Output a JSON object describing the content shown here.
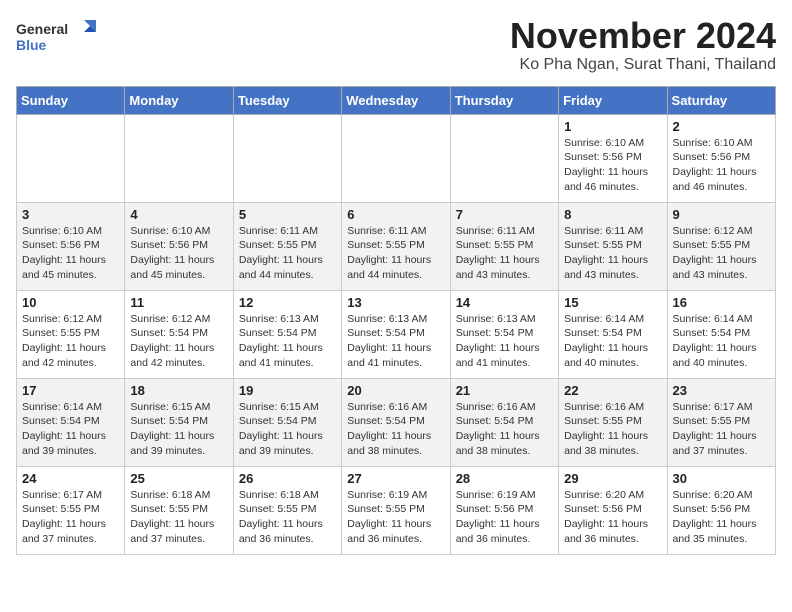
{
  "logo": {
    "line1": "General",
    "line2": "Blue"
  },
  "title": {
    "month": "November 2024",
    "location": "Ko Pha Ngan, Surat Thani, Thailand"
  },
  "weekdays": [
    "Sunday",
    "Monday",
    "Tuesday",
    "Wednesday",
    "Thursday",
    "Friday",
    "Saturday"
  ],
  "weeks": [
    [
      {
        "day": "",
        "info": ""
      },
      {
        "day": "",
        "info": ""
      },
      {
        "day": "",
        "info": ""
      },
      {
        "day": "",
        "info": ""
      },
      {
        "day": "",
        "info": ""
      },
      {
        "day": "1",
        "info": "Sunrise: 6:10 AM\nSunset: 5:56 PM\nDaylight: 11 hours and 46 minutes."
      },
      {
        "day": "2",
        "info": "Sunrise: 6:10 AM\nSunset: 5:56 PM\nDaylight: 11 hours and 46 minutes."
      }
    ],
    [
      {
        "day": "3",
        "info": "Sunrise: 6:10 AM\nSunset: 5:56 PM\nDaylight: 11 hours and 45 minutes."
      },
      {
        "day": "4",
        "info": "Sunrise: 6:10 AM\nSunset: 5:56 PM\nDaylight: 11 hours and 45 minutes."
      },
      {
        "day": "5",
        "info": "Sunrise: 6:11 AM\nSunset: 5:55 PM\nDaylight: 11 hours and 44 minutes."
      },
      {
        "day": "6",
        "info": "Sunrise: 6:11 AM\nSunset: 5:55 PM\nDaylight: 11 hours and 44 minutes."
      },
      {
        "day": "7",
        "info": "Sunrise: 6:11 AM\nSunset: 5:55 PM\nDaylight: 11 hours and 43 minutes."
      },
      {
        "day": "8",
        "info": "Sunrise: 6:11 AM\nSunset: 5:55 PM\nDaylight: 11 hours and 43 minutes."
      },
      {
        "day": "9",
        "info": "Sunrise: 6:12 AM\nSunset: 5:55 PM\nDaylight: 11 hours and 43 minutes."
      }
    ],
    [
      {
        "day": "10",
        "info": "Sunrise: 6:12 AM\nSunset: 5:55 PM\nDaylight: 11 hours and 42 minutes."
      },
      {
        "day": "11",
        "info": "Sunrise: 6:12 AM\nSunset: 5:54 PM\nDaylight: 11 hours and 42 minutes."
      },
      {
        "day": "12",
        "info": "Sunrise: 6:13 AM\nSunset: 5:54 PM\nDaylight: 11 hours and 41 minutes."
      },
      {
        "day": "13",
        "info": "Sunrise: 6:13 AM\nSunset: 5:54 PM\nDaylight: 11 hours and 41 minutes."
      },
      {
        "day": "14",
        "info": "Sunrise: 6:13 AM\nSunset: 5:54 PM\nDaylight: 11 hours and 41 minutes."
      },
      {
        "day": "15",
        "info": "Sunrise: 6:14 AM\nSunset: 5:54 PM\nDaylight: 11 hours and 40 minutes."
      },
      {
        "day": "16",
        "info": "Sunrise: 6:14 AM\nSunset: 5:54 PM\nDaylight: 11 hours and 40 minutes."
      }
    ],
    [
      {
        "day": "17",
        "info": "Sunrise: 6:14 AM\nSunset: 5:54 PM\nDaylight: 11 hours and 39 minutes."
      },
      {
        "day": "18",
        "info": "Sunrise: 6:15 AM\nSunset: 5:54 PM\nDaylight: 11 hours and 39 minutes."
      },
      {
        "day": "19",
        "info": "Sunrise: 6:15 AM\nSunset: 5:54 PM\nDaylight: 11 hours and 39 minutes."
      },
      {
        "day": "20",
        "info": "Sunrise: 6:16 AM\nSunset: 5:54 PM\nDaylight: 11 hours and 38 minutes."
      },
      {
        "day": "21",
        "info": "Sunrise: 6:16 AM\nSunset: 5:54 PM\nDaylight: 11 hours and 38 minutes."
      },
      {
        "day": "22",
        "info": "Sunrise: 6:16 AM\nSunset: 5:55 PM\nDaylight: 11 hours and 38 minutes."
      },
      {
        "day": "23",
        "info": "Sunrise: 6:17 AM\nSunset: 5:55 PM\nDaylight: 11 hours and 37 minutes."
      }
    ],
    [
      {
        "day": "24",
        "info": "Sunrise: 6:17 AM\nSunset: 5:55 PM\nDaylight: 11 hours and 37 minutes."
      },
      {
        "day": "25",
        "info": "Sunrise: 6:18 AM\nSunset: 5:55 PM\nDaylight: 11 hours and 37 minutes."
      },
      {
        "day": "26",
        "info": "Sunrise: 6:18 AM\nSunset: 5:55 PM\nDaylight: 11 hours and 36 minutes."
      },
      {
        "day": "27",
        "info": "Sunrise: 6:19 AM\nSunset: 5:55 PM\nDaylight: 11 hours and 36 minutes."
      },
      {
        "day": "28",
        "info": "Sunrise: 6:19 AM\nSunset: 5:56 PM\nDaylight: 11 hours and 36 minutes."
      },
      {
        "day": "29",
        "info": "Sunrise: 6:20 AM\nSunset: 5:56 PM\nDaylight: 11 hours and 36 minutes."
      },
      {
        "day": "30",
        "info": "Sunrise: 6:20 AM\nSunset: 5:56 PM\nDaylight: 11 hours and 35 minutes."
      }
    ]
  ]
}
